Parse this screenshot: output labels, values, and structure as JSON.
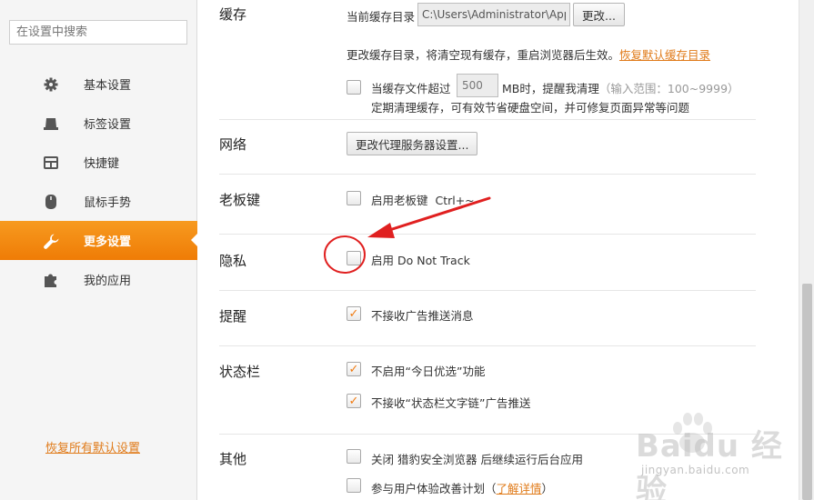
{
  "sidebar": {
    "search_placeholder": "在设置中搜索",
    "items": [
      {
        "label": "基本设置",
        "icon": "gear-icon"
      },
      {
        "label": "标签设置",
        "icon": "tab-icon"
      },
      {
        "label": "快捷键",
        "icon": "keyboard-icon"
      },
      {
        "label": "鼠标手势",
        "icon": "mouse-icon"
      },
      {
        "label": "更多设置",
        "icon": "wrench-icon",
        "active": true
      },
      {
        "label": "我的应用",
        "icon": "puzzle-icon"
      }
    ],
    "reset_link": "恢复所有默认设置"
  },
  "cache": {
    "title": "缓存",
    "current_dir_label": "当前缓存目录",
    "path_value": "C:\\Users\\Administrator\\AppD",
    "change_button": "更改...",
    "change_note": "更改缓存目录，将清空现有缓存，重启浏览器后生效。",
    "restore_link": "恢复默认缓存目录",
    "limit_label_before": "当缓存文件超过",
    "limit_value": "500",
    "limit_label_after": "MB时，提醒我清理",
    "limit_range": "（输入范围：100~9999）",
    "limit_desc": "定期清理缓存，可有效节省硬盘空间，并可修复页面异常等问题",
    "limit_checked": false
  },
  "network": {
    "title": "网络",
    "proxy_button": "更改代理服务器设置..."
  },
  "boss_key": {
    "title": "老板键",
    "label": "启用老板键",
    "shortcut": "Ctrl+~",
    "checked": false
  },
  "privacy": {
    "title": "隐私",
    "label": "启用 Do Not Track",
    "checked": false
  },
  "reminder": {
    "title": "提醒",
    "label": "不接收广告推送消息",
    "checked": true
  },
  "statusbar": {
    "title": "状态栏",
    "options": [
      {
        "label": "不启用“今日优选”功能",
        "checked": true
      },
      {
        "label": "不接收“状态栏文字链”广告推送",
        "checked": true
      }
    ]
  },
  "other": {
    "title": "其他",
    "options": [
      {
        "label": "关闭 猎豹安全浏览器 后继续运行后台应用",
        "checked": false
      },
      {
        "label": "参与用户体验改善计划",
        "checked": false,
        "paren_open": "（",
        "link": "了解详情",
        "paren_close": "）"
      }
    ]
  },
  "watermark": {
    "brand": "Baidu 经验",
    "url": "jingyan.baidu.com"
  },
  "colors": {
    "accent_orange": "#f08a14",
    "annotation_red": "#e02020",
    "check_orange": "#f07a10"
  }
}
